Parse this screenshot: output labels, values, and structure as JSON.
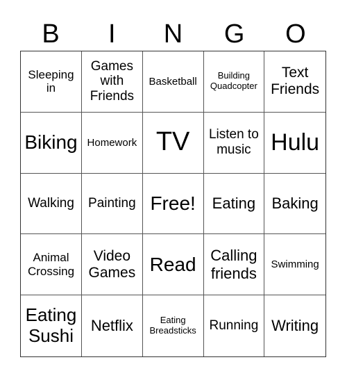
{
  "header": {
    "letters": [
      "B",
      "I",
      "N",
      "G",
      "O"
    ]
  },
  "cells": [
    "Sleeping in",
    "Games with Friends",
    "Basketball",
    "Building Quadcopter",
    "Text Friends",
    "Biking",
    "Homework",
    "TV",
    "Listen to music",
    "Hulu",
    "Walking",
    "Painting",
    "Free!",
    "Eating",
    "Baking",
    "Animal Crossing",
    "Video Games",
    "Read",
    "Calling friends",
    "Swimming",
    "Eating Sushi",
    "Netflix",
    "Eating Breadsticks",
    "Running",
    "Writing"
  ]
}
